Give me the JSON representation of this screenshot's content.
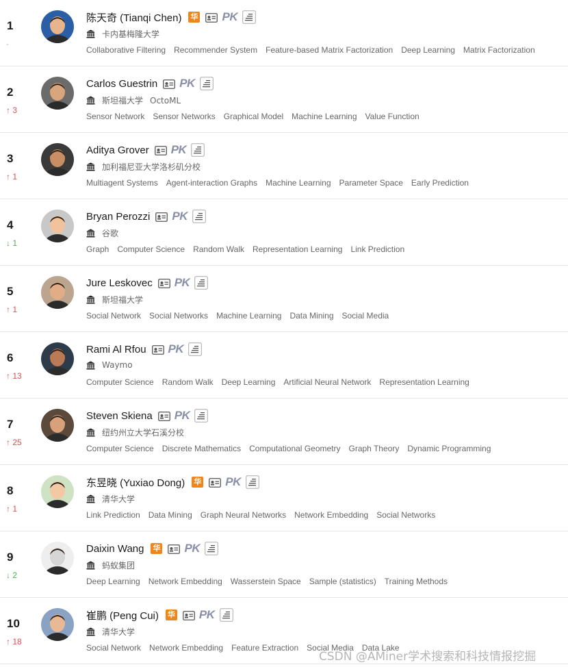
{
  "colors": {
    "up": "#d9534f",
    "down": "#4caf50",
    "hua_badge": "#f08519",
    "pk": "#8a8fa8"
  },
  "icons": {
    "hua_badge": "华",
    "card": "id-card-icon",
    "pk": "PK",
    "list": "list-icon",
    "org": "building-icon"
  },
  "scholars": [
    {
      "rank": "1",
      "delta": "-",
      "delta_dir": "none",
      "name": "陈天奇 (Tianqi Chen)",
      "hua": true,
      "orgs": [
        "卡内基梅隆大学"
      ],
      "tags": [
        "Collaborative Filtering",
        "Recommender System",
        "Feature-based Matrix Factorization",
        "Deep Learning",
        "Matrix Factorization"
      ]
    },
    {
      "rank": "2",
      "delta": "↑ 3",
      "delta_dir": "up",
      "name": "Carlos Guestrin",
      "hua": false,
      "orgs": [
        "斯坦福大学",
        "OctoML"
      ],
      "tags": [
        "Sensor Network",
        "Sensor Networks",
        "Graphical Model",
        "Machine Learning",
        "Value Function"
      ]
    },
    {
      "rank": "3",
      "delta": "↑ 1",
      "delta_dir": "up",
      "name": "Aditya Grover",
      "hua": false,
      "orgs": [
        "加利福尼亚大学洛杉矶分校"
      ],
      "tags": [
        "Multiagent Systems",
        "Agent-interaction Graphs",
        "Machine Learning",
        "Parameter Space",
        "Early Prediction"
      ]
    },
    {
      "rank": "4",
      "delta": "↓ 1",
      "delta_dir": "down",
      "name": "Bryan Perozzi",
      "hua": false,
      "orgs": [
        "谷歌"
      ],
      "tags": [
        "Graph",
        "Computer Science",
        "Random Walk",
        "Representation Learning",
        "Link Prediction"
      ]
    },
    {
      "rank": "5",
      "delta": "↑ 1",
      "delta_dir": "up",
      "name": "Jure Leskovec",
      "hua": false,
      "orgs": [
        "斯坦福大学"
      ],
      "tags": [
        "Social Network",
        "Social Networks",
        "Machine Learning",
        "Data Mining",
        "Social Media"
      ]
    },
    {
      "rank": "6",
      "delta": "↑ 13",
      "delta_dir": "up",
      "name": "Rami Al Rfou",
      "hua": false,
      "orgs": [
        "Waymo"
      ],
      "tags": [
        "Computer Science",
        "Random Walk",
        "Deep Learning",
        "Artificial Neural Network",
        "Representation Learning"
      ]
    },
    {
      "rank": "7",
      "delta": "↑ 25",
      "delta_dir": "up",
      "name": "Steven Skiena",
      "hua": false,
      "orgs": [
        "纽约州立大学石溪分校"
      ],
      "tags": [
        "Computer Science",
        "Discrete Mathematics",
        "Computational Geometry",
        "Graph Theory",
        "Dynamic Programming"
      ]
    },
    {
      "rank": "8",
      "delta": "↑ 1",
      "delta_dir": "up",
      "name": "东昱晓 (Yuxiao Dong)",
      "hua": true,
      "orgs": [
        "清华大学"
      ],
      "tags": [
        "Link Prediction",
        "Data Mining",
        "Graph Neural Networks",
        "Network Embedding",
        "Social Networks"
      ]
    },
    {
      "rank": "9",
      "delta": "↓ 2",
      "delta_dir": "down",
      "name": "Daixin Wang",
      "hua": true,
      "orgs": [
        "蚂蚁集团"
      ],
      "tags": [
        "Deep Learning",
        "Network Embedding",
        "Wasserstein Space",
        "Sample (statistics)",
        "Training Methods"
      ]
    },
    {
      "rank": "10",
      "delta": "↑ 18",
      "delta_dir": "up",
      "name": "崔鹏 (Peng Cui)",
      "hua": true,
      "orgs": [
        "清华大学"
      ],
      "tags": [
        "Social Network",
        "Network Embedding",
        "Feature Extraction",
        "Social Media",
        "Data Lake"
      ]
    }
  ],
  "watermark": "CSDN @AMiner学术搜索和科技情报挖掘"
}
